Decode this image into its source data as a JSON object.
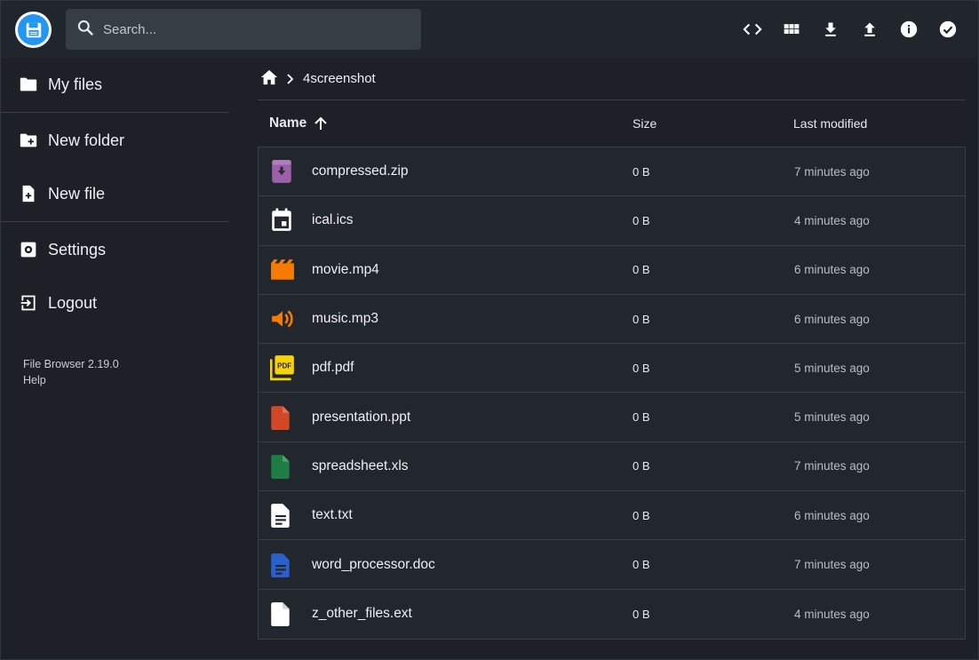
{
  "header": {
    "search_placeholder": "Search...",
    "actions": [
      "code-icon",
      "grid-view-icon",
      "download-icon",
      "upload-icon",
      "info-icon",
      "check-circle-icon"
    ]
  },
  "sidebar": {
    "items": [
      {
        "label": "My files",
        "icon": "folder-icon"
      },
      {
        "label": "New folder",
        "icon": "folder-plus-icon"
      },
      {
        "label": "New file",
        "icon": "file-plus-icon"
      },
      {
        "label": "Settings",
        "icon": "settings-icon"
      },
      {
        "label": "Logout",
        "icon": "logout-icon"
      }
    ],
    "version": "File Browser 2.19.0",
    "help": "Help"
  },
  "breadcrumb": {
    "current": "4screenshot"
  },
  "columns": {
    "name": "Name",
    "size": "Size",
    "modified": "Last modified"
  },
  "files": [
    {
      "name": "compressed.zip",
      "size": "0 B",
      "modified": "7 minutes ago",
      "icon": "archive-icon",
      "color": "#9a61a8"
    },
    {
      "name": "ical.ics",
      "size": "0 B",
      "modified": "4 minutes ago",
      "icon": "calendar-icon",
      "color": "#ffffff"
    },
    {
      "name": "movie.mp4",
      "size": "0 B",
      "modified": "6 minutes ago",
      "icon": "video-icon",
      "color": "#f57c00"
    },
    {
      "name": "music.mp3",
      "size": "0 B",
      "modified": "6 minutes ago",
      "icon": "audio-icon",
      "color": "#f57c00"
    },
    {
      "name": "pdf.pdf",
      "size": "0 B",
      "modified": "5 minutes ago",
      "icon": "pdf-icon",
      "color": "#f6d20b"
    },
    {
      "name": "presentation.ppt",
      "size": "0 B",
      "modified": "5 minutes ago",
      "icon": "presentation-icon",
      "color": "#d24726"
    },
    {
      "name": "spreadsheet.xls",
      "size": "0 B",
      "modified": "7 minutes ago",
      "icon": "spreadsheet-icon",
      "color": "#1e7c45"
    },
    {
      "name": "text.txt",
      "size": "0 B",
      "modified": "6 minutes ago",
      "icon": "text-file-icon",
      "color": "#ffffff"
    },
    {
      "name": "word_processor.doc",
      "size": "0 B",
      "modified": "7 minutes ago",
      "icon": "document-icon",
      "color": "#2a5fce"
    },
    {
      "name": "z_other_files.ext",
      "size": "0 B",
      "modified": "4 minutes ago",
      "icon": "file-icon",
      "color": "#ffffff"
    }
  ]
}
